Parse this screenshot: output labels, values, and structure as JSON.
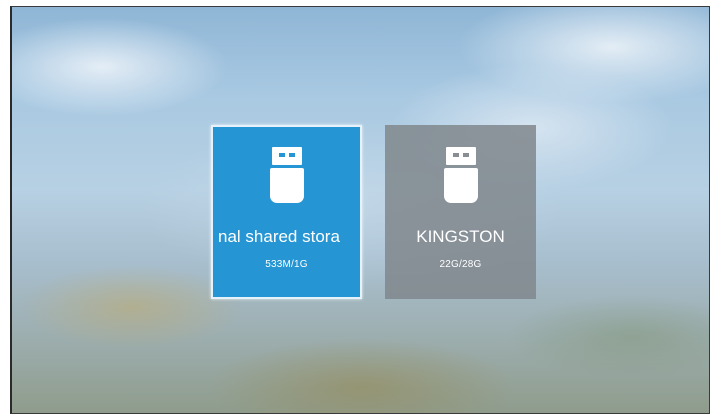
{
  "devices": [
    {
      "name": "nal shared stora",
      "size": "533M/1G",
      "icon": "usb-drive-icon",
      "selected": true
    },
    {
      "name": "KINGSTON",
      "size": "22G/28G",
      "icon": "usb-drive-icon",
      "selected": false
    }
  ],
  "colors": {
    "selected_tile": "#2595d3",
    "normal_tile": "#80878c",
    "text": "#ffffff"
  }
}
